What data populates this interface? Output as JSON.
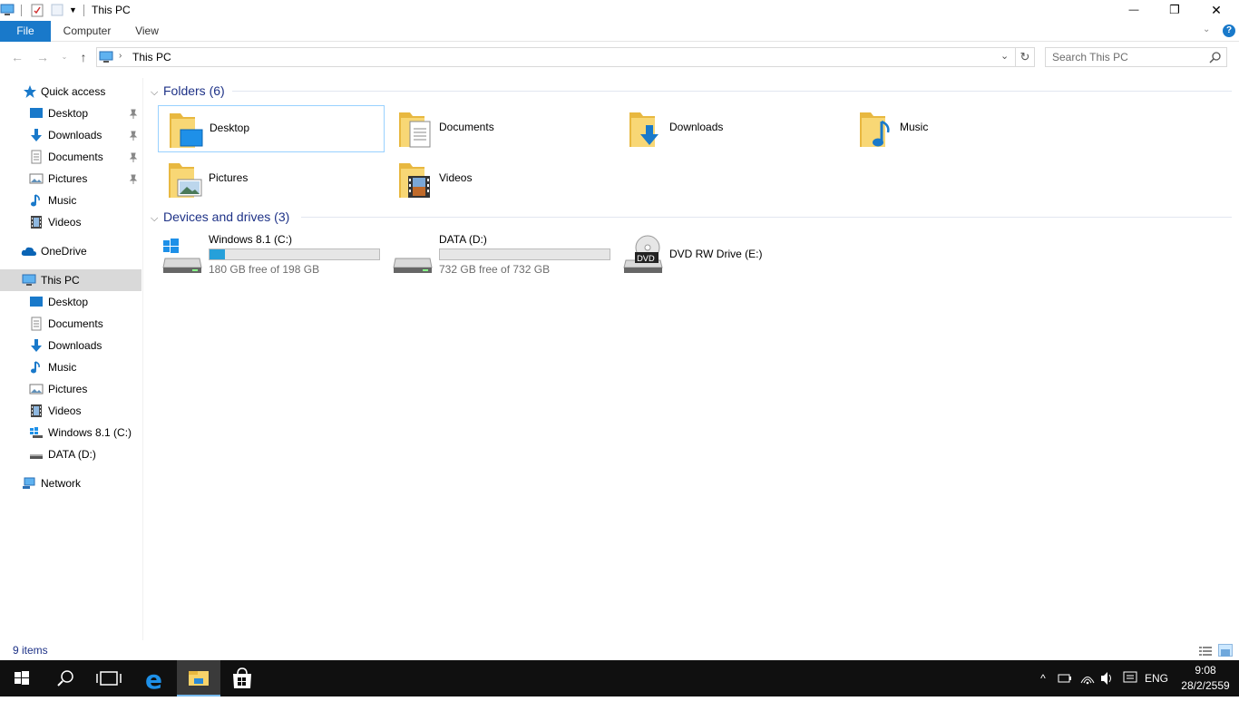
{
  "window": {
    "title": "This PC",
    "controls": {
      "minimize": "—",
      "restore": "❐",
      "close": "✕"
    }
  },
  "ribbon": {
    "tabs": [
      {
        "label": "File",
        "active": true
      },
      {
        "label": "Computer",
        "active": false
      },
      {
        "label": "View",
        "active": false
      }
    ],
    "help": "?"
  },
  "address": {
    "path": "This PC",
    "search_placeholder": "Search This PC"
  },
  "nav_pane": {
    "quick_access": {
      "label": "Quick access",
      "items": [
        {
          "label": "Desktop",
          "icon": "desktop-icon",
          "pinned": true
        },
        {
          "label": "Downloads",
          "icon": "downloads-icon",
          "pinned": true
        },
        {
          "label": "Documents",
          "icon": "documents-icon",
          "pinned": true
        },
        {
          "label": "Pictures",
          "icon": "pictures-icon",
          "pinned": true
        },
        {
          "label": "Music",
          "icon": "music-icon",
          "pinned": false
        },
        {
          "label": "Videos",
          "icon": "videos-icon",
          "pinned": false
        }
      ]
    },
    "onedrive": "OneDrive",
    "this_pc": {
      "label": "This PC",
      "selected": true,
      "items": [
        {
          "label": "Desktop",
          "icon": "desktop-icon"
        },
        {
          "label": "Documents",
          "icon": "documents-icon"
        },
        {
          "label": "Downloads",
          "icon": "downloads-icon"
        },
        {
          "label": "Music",
          "icon": "music-icon"
        },
        {
          "label": "Pictures",
          "icon": "pictures-icon"
        },
        {
          "label": "Videos",
          "icon": "videos-icon"
        },
        {
          "label": "Windows 8.1 (C:)",
          "icon": "system-drive-icon"
        },
        {
          "label": "DATA (D:)",
          "icon": "drive-icon"
        }
      ]
    },
    "network": "Network"
  },
  "content": {
    "folders_header": "Folders (6)",
    "folders": [
      {
        "label": "Desktop",
        "icon": "desktop-folder-icon",
        "selected": true
      },
      {
        "label": "Documents",
        "icon": "documents-folder-icon",
        "selected": false
      },
      {
        "label": "Downloads",
        "icon": "downloads-folder-icon",
        "selected": false
      },
      {
        "label": "Music",
        "icon": "music-folder-icon",
        "selected": false
      },
      {
        "label": "Pictures",
        "icon": "pictures-folder-icon",
        "selected": false
      },
      {
        "label": "Videos",
        "icon": "videos-folder-icon",
        "selected": false
      }
    ],
    "drives_header": "Devices and drives (3)",
    "drives": [
      {
        "label": "Windows 8.1 (C:)",
        "free": "180 GB free of 198 GB",
        "used_fraction": 0.09,
        "icon": "system-drive-icon"
      },
      {
        "label": "DATA (D:)",
        "free": "732 GB free of 732 GB",
        "used_fraction": 0.0,
        "icon": "drive-icon"
      },
      {
        "label": "DVD RW Drive (E:)",
        "icon": "dvd-drive-icon",
        "dvd_text": "DVD"
      }
    ]
  },
  "status_bar": {
    "count": "9 items"
  },
  "taskbar": {
    "apps": [
      "start-icon",
      "search-icon",
      "task-view-icon",
      "edge-icon",
      "file-explorer-icon",
      "store-icon"
    ],
    "active_app": "file-explorer-icon",
    "language": "ENG",
    "time": "9:08",
    "date": "28/2/2559"
  },
  "colors": {
    "accent": "#1979ca",
    "header": "#1e3287",
    "bar": "#26a0da",
    "taskbar": "#101010"
  }
}
